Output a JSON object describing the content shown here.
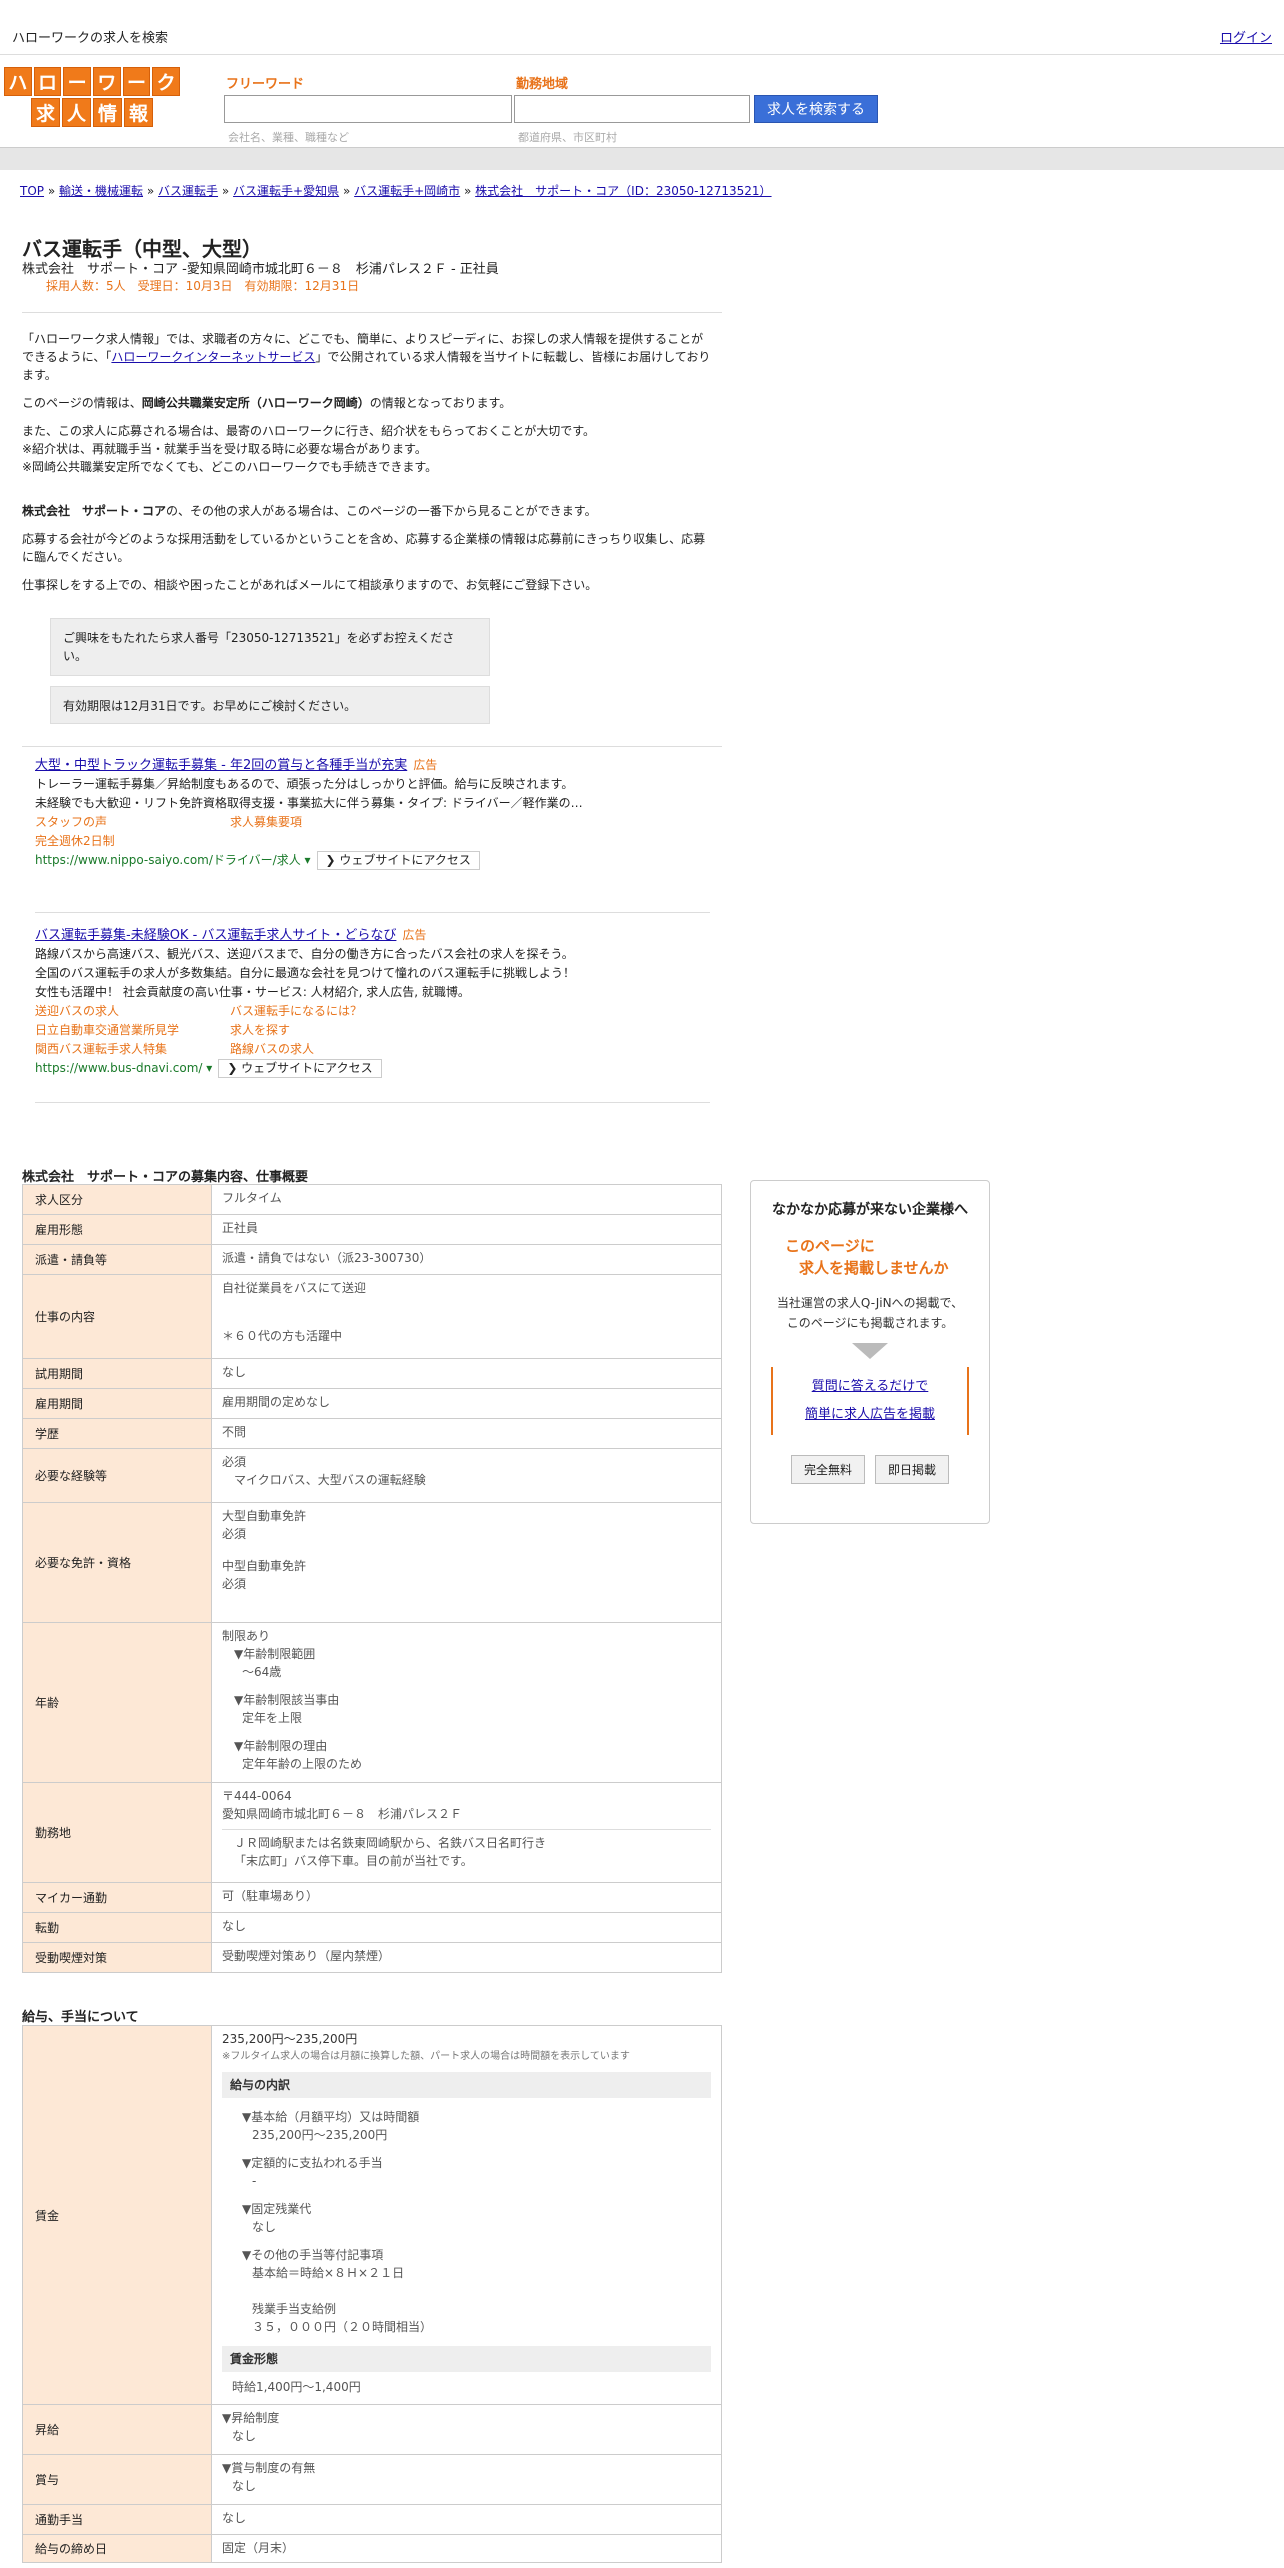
{
  "topbar": {
    "title": "ハローワークの求人を検索",
    "login": "ログイン"
  },
  "header": {
    "logo_row1": [
      "ハ",
      "ロ",
      "ー",
      "ワ",
      "ー",
      "ク"
    ],
    "logo_row2": [
      "求",
      "人",
      "情",
      "報"
    ],
    "free_word_label": "フリーワード",
    "free_word_hint": "会社名、業種、職種など",
    "area_label": "勤務地域",
    "area_hint": "都道府県、市区町村",
    "search_button": "求人を検索する"
  },
  "breadcrumb": [
    "TOP",
    "輸送・機械運転",
    "バス運転手",
    "バス運転手+愛知県",
    "バス運転手+岡崎市",
    "株式会社　サポート・コア（ID：23050-12713521）"
  ],
  "breadcrumb_sep": "»",
  "job": {
    "title": "バス運転手（中型、大型）",
    "subtitle": "株式会社　サポート・コア -愛知県岡崎市城北町６－８　杉浦パレス２Ｆ - 正社員",
    "meta": "採用人数：5人　受理日：10月3日　有効期限：12月31日"
  },
  "intro": {
    "p1_a": "「ハローワーク求人情報」では、求職者の方々に、どこでも、簡単に、よりスピーディに、お探しの求人情報を提供することができるように、「",
    "p1_link": "ハローワークインターネットサービス",
    "p1_b": "」で公開されている求人情報を当サイトに転載し、皆様にお届けしております。",
    "p2_a": "このページの情報は、",
    "p2_bold": "岡崎公共職業安定所（ハローワーク岡崎）",
    "p2_b": "の情報となっております。",
    "p3_1": "また、この求人に応募される場合は、最寄のハローワークに行き、紹介状をもらっておくことが大切です。",
    "p3_2": "※紹介状は、再就職手当・就業手当を受け取る時に必要な場合があります。",
    "p3_3": "※岡崎公共職業安定所でなくても、どこのハローワークでも手続きできます。",
    "p4_bold": "株式会社　サポート・コア",
    "p4_b": "の、その他の求人がある場合は、このページの一番下から見ることができます。",
    "p5": "応募する会社が今どのような採用活動をしているかということを含め、応募する企業様の情報は応募前にきっちり収集し、応募に臨んでください。",
    "p6": "仕事探しをする上での、相談や困ったことがあればメールにて相談承りますので、お気軽にご登録下さい。"
  },
  "notes": {
    "n1": "ご興味をもたれたら求人番号「23050-12713521」を必ずお控えください。",
    "n2": "有効期限は12月31日です。お早めにご検討ください。"
  },
  "ads": [
    {
      "title": "大型・中型トラック運転手募集 - 年2回の賞与と各種手当が充実",
      "mark": "広告",
      "lines": [
        "トレーラー運転手募集／昇給制度もあるので、頑張った分はしっかりと評価。給与に反映されます。",
        "未経験でも大歓迎・リフト免許資格取得支援・事業拡大に伴う募集・タイプ: ドライバー／軽作業の…"
      ],
      "subs": [
        "スタッフの声",
        "求人募集要項",
        "完全週休2日制",
        ""
      ],
      "url": "https://www.nippo-saiyo.com/ドライバー/求人 ▾",
      "visit": "❯ ウェブサイトにアクセス"
    },
    {
      "title": "バス運転手募集-未経験OK - バス運転手求人サイト・どらなび",
      "mark": "広告",
      "lines": [
        "路線バスから高速バス、観光バス、送迎バスまで、自分の働き方に合ったバス会社の求人を探そう。",
        "全国のバス運転手の求人が多数集結。自分に最適な会社を見つけて憧れのバス運転手に挑戦しよう！",
        "女性も活躍中！ 社会貢献度の高い仕事・サービス: 人材紹介, 求人広告, 就職博。"
      ],
      "subs": [
        "送迎バスの求人",
        "バス運転手になるには？",
        "日立自動車交通営業所見学",
        "求人を探す",
        "関西バス運転手求人特集",
        "路線バスの求人"
      ],
      "url": "https://www.bus-dnavi.com/ ▾",
      "visit": "❯ ウェブサイトにアクセス"
    }
  ],
  "detail": {
    "title": "株式会社　サポート・コアの募集内容、仕事概要",
    "rows": {
      "kubun": {
        "label": "求人区分",
        "value": "フルタイム"
      },
      "keitai": {
        "label": "雇用形態",
        "value": "正社員"
      },
      "haken": {
        "label": "派遣・請負等",
        "value": "派遣・請負ではない（派23-300730）"
      },
      "shigoto": {
        "label": "仕事の内容",
        "v1": "自社従業員をバスにて送迎",
        "v2": "＊６０代の方も活躍中"
      },
      "shiyou": {
        "label": "試用期間",
        "value": "なし"
      },
      "kikan": {
        "label": "雇用期間",
        "value": "雇用期間の定めなし"
      },
      "gakureki": {
        "label": "学歴",
        "value": "不問"
      },
      "keiken": {
        "label": "必要な経験等",
        "v1": "必須",
        "v2": "マイクロバス、大型バスの運転経験"
      },
      "menkyo": {
        "label": "必要な免許・資格",
        "v1": "大型自動車免許",
        "v2": "必須",
        "v3": "中型自動車免許",
        "v4": "必須"
      },
      "nenrei": {
        "label": "年齢",
        "v1": "制限あり",
        "v2": "▼年齢制限範囲",
        "v3": "〜64歳",
        "v4": "▼年齢制限該当事由",
        "v5": "定年を上限",
        "v6": "▼年齢制限の理由",
        "v7": "定年年齢の上限のため"
      },
      "kinmu": {
        "label": "勤務地",
        "v1": "〒444-0064",
        "v2": "愛知県岡崎市城北町６－８　杉浦パレス２Ｆ",
        "v3": "ＪＲ岡崎駅または名鉄東岡崎駅から、名鉄バス日名町行き",
        "v4": "「末広町」バス停下車。目の前が当社です。"
      },
      "mycar": {
        "label": "マイカー通勤",
        "value": "可（駐車場あり）"
      },
      "tenkin": {
        "label": "転勤",
        "value": "なし"
      },
      "judo": {
        "label": "受動喫煙対策",
        "value": "受動喫煙対策あり（屋内禁煙）"
      }
    }
  },
  "salary": {
    "title": "給与、手当について",
    "chingin": {
      "label": "賃金",
      "range": "235,200円〜235,200円",
      "note": "※フルタイム求人の場合は月額に換算した額、パート求人の場合は時間額を表示しています",
      "breakdown_head": "給与の内訳",
      "b1": "▼基本給（月額平均）又は時間額",
      "b1v": "235,200円〜235,200円",
      "b2": "▼定額的に支払われる手当",
      "b2v": "-",
      "b3": "▼固定残業代",
      "b3v": "なし",
      "b4": "▼その他の手当等付記事項",
      "b4v": "基本給＝時給×８Ｈ×２１日",
      "b5": "残業手当支給例",
      "b5v": "３５，０００円（２０時間相当）",
      "form_head": "賃金形態",
      "form_v": "時給1,400円〜1,400円"
    },
    "shokyu": {
      "label": "昇給",
      "v1": "▼昇給制度",
      "v2": "なし"
    },
    "shoyo": {
      "label": "賞与",
      "v1": "▼賞与制度の有無",
      "v2": "なし"
    },
    "tsukin": {
      "label": "通勤手当",
      "value": "なし"
    },
    "shime": {
      "label": "給与の締め日",
      "value": "固定（月末）"
    }
  },
  "side": {
    "title": "なかなか応募が来ない企業様へ",
    "catch1": "このページに",
    "catch2": "求人を掲載しませんか",
    "desc1": "当社運営の求人Q-JiNへの掲載で、",
    "desc2": "このページにも掲載されます。",
    "link1": "質問に答えるだけで",
    "link2": "簡単に求人広告を掲載",
    "btn1": "完全無料",
    "btn2": "即日掲載"
  }
}
